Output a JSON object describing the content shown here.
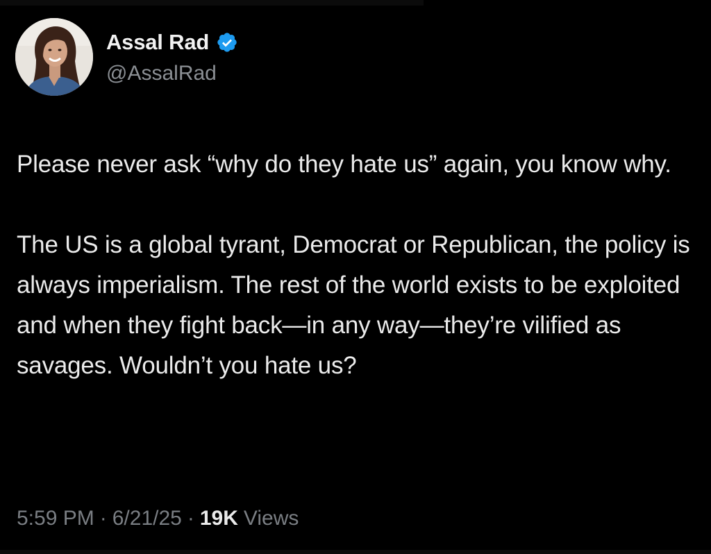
{
  "author": {
    "display_name": "Assal Rad",
    "handle": "@AssalRad",
    "verified_icon": "verified-badge-icon",
    "verified_color": "#1d9bf0"
  },
  "tweet": {
    "paragraphs": [
      "Please never ask “why do they hate us” again, you know why.",
      "The US is a global tyrant, Democrat or Republican, the policy is always imperialism. The rest of the world exists to be exploited and when they fight back—in any way—they’re vilified as savages. Wouldn’t you hate us?"
    ]
  },
  "meta": {
    "time": "5:59 PM",
    "separator": "·",
    "date": "6/21/25",
    "views_count": "19K",
    "views_label": "Views"
  },
  "colors": {
    "background": "#000000",
    "text": "#e7e9ea",
    "secondary": "#7a7e83"
  }
}
